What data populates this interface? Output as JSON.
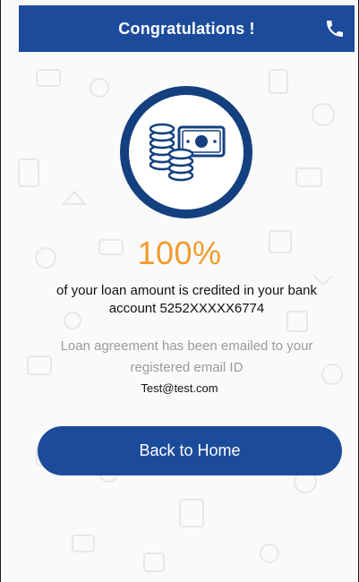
{
  "header": {
    "title": "Congratulations !"
  },
  "success": {
    "percent": "100%",
    "credited_line1": "of your loan amount is credited in your bank",
    "credited_line2": "account 5252XXXXX6774",
    "agreement_line1": "Loan agreement has been emailed to your",
    "agreement_line2": "registered email ID",
    "email": "Test@test.com"
  },
  "actions": {
    "home_label": "Back to Home"
  },
  "colors": {
    "primary": "#1c4b9c",
    "accent": "#f29a2e",
    "muted_text": "#9a9a9a"
  },
  "icons": {
    "header_action": "phone-icon",
    "hero": "money-coins-icon"
  }
}
